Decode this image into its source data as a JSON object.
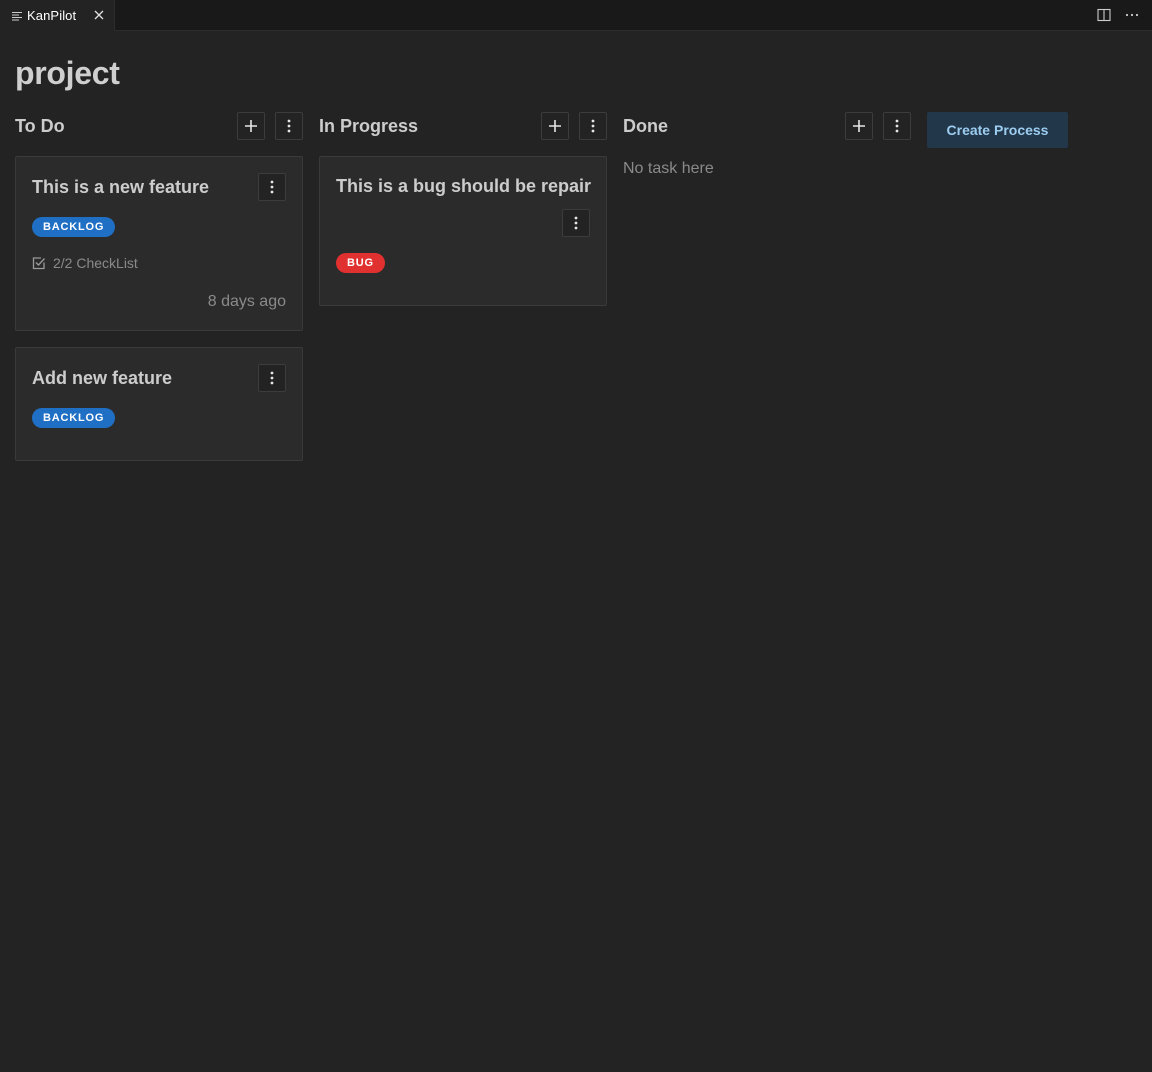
{
  "tab": {
    "title": "KanPilot",
    "icon": "list-icon"
  },
  "page": {
    "title": "project"
  },
  "columns": [
    {
      "title": "To Do",
      "cards": [
        {
          "title": "This is a new feature",
          "tag": "BACKLOG",
          "tag_color": "#1f6fc4",
          "checklist": "2/2 CheckList",
          "date": "8 days ago"
        },
        {
          "title": "Add new feature",
          "tag": "BACKLOG",
          "tag_color": "#1f6fc4"
        }
      ]
    },
    {
      "title": "In Progress",
      "cards": [
        {
          "title": "This is a bug should be repair",
          "tag": "BUG",
          "tag_color": "#e0302f"
        }
      ]
    },
    {
      "title": "Done",
      "cards": [],
      "empty_text": "No task here"
    }
  ],
  "create_button": {
    "label": "Create Process"
  },
  "colors": {
    "background": "#232323",
    "card": "#2b2b2b",
    "accent_button": "#22374a",
    "accent_text": "#9ccdf0"
  }
}
